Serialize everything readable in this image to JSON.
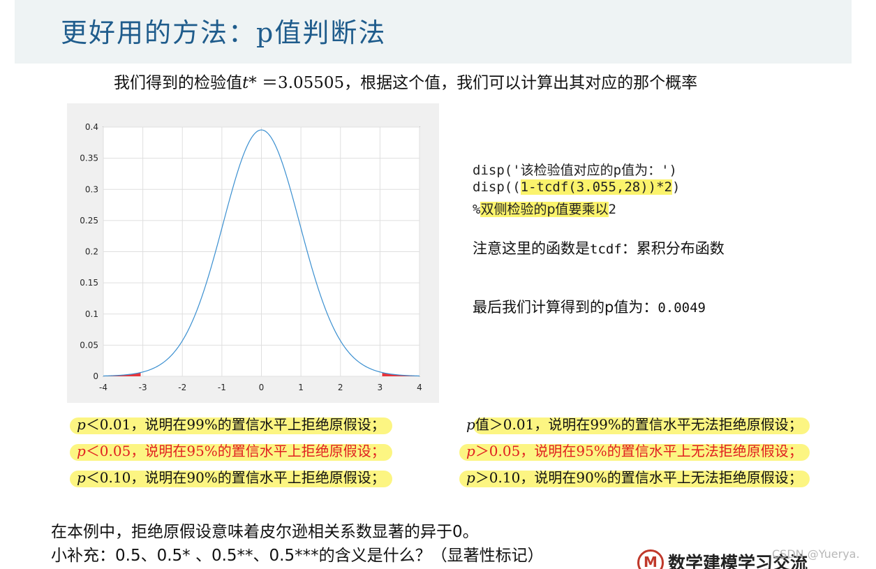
{
  "title": "更好用的方法：p值判断法",
  "intro": {
    "prefix": "我们得到的检验值",
    "symbol": "t*",
    "equals": " ＝3.05505，",
    "suffix": "根据这个值，我们可以计算出其对应的那个概率"
  },
  "code": {
    "line1": "disp('该检验值对应的p值为：')",
    "line2_pre": "disp((",
    "line2_hl": "1-tcdf(3.055,28))*2",
    "line2_post": ")",
    "line3_pct": "%",
    "line3_hl": "双侧检验的p值要乘以",
    "line3_post": "2"
  },
  "notes": {
    "function_pre": "注意这里的函数是",
    "function_mono": "tcdf",
    "function_post": "：累积分布函数",
    "result_pre": "最后我们计算得到的p值为：",
    "result_mono": "0.0049"
  },
  "rules_left": [
    {
      "p": "p",
      "text": "＜0.01，说明在99%的置信水平上拒绝原假设；"
    },
    {
      "p": "p",
      "text": "＜0.05，说明在95%的置信水平上拒绝原假设；"
    },
    {
      "p": "p",
      "text": "＜0.10，说明在90%的置信水平上拒绝原假设；"
    }
  ],
  "rules_right": [
    {
      "p": "p",
      "text": "值＞0.01，说明在99%的置信水平无法拒绝原假设；"
    },
    {
      "p": "p",
      "text": "＞0.05，说明在95%的置信水平上无法拒绝原假设；"
    },
    {
      "p": "p",
      "text": "＞0.10，说明在90%的置信水平上无法拒绝原假设；"
    }
  ],
  "bottom": {
    "line1": "在本例中，拒绝原假设意味着皮尔逊相关系数显著的异于0。",
    "line2": "小补充：0.5、0.5* 、0.5**、0.5***的含义是什么？（显著性标记）"
  },
  "logo_text": "数学建模学习交流",
  "logo_mark": "M",
  "watermark": "CSDN @Yuerya.",
  "chart_data": {
    "type": "line",
    "title": "",
    "xlabel": "",
    "ylabel": "",
    "xlim": [
      -4,
      4
    ],
    "ylim": [
      0,
      0.4
    ],
    "x_ticks": [
      "-4",
      "-3",
      "-2",
      "-1",
      "0",
      "1",
      "2",
      "3",
      "4"
    ],
    "y_ticks": [
      "0",
      "0.05",
      "0.1",
      "0.15",
      "0.2",
      "0.25",
      "0.3",
      "0.35",
      "0.4"
    ],
    "grid": true,
    "series": [
      {
        "distribution": "t",
        "df": 28,
        "x_range": [
          -4,
          4
        ],
        "color": "#3a8fd0"
      }
    ],
    "shaded_tails": {
      "left": [
        -4,
        -3.055
      ],
      "right": [
        3.055,
        4
      ],
      "color": "#e8353b"
    }
  },
  "colors": {
    "title": "#1f5c8c",
    "highlight": "#fbf36c",
    "red": "#e02020",
    "curve": "#3a8fd0",
    "tail": "#e8353b"
  }
}
